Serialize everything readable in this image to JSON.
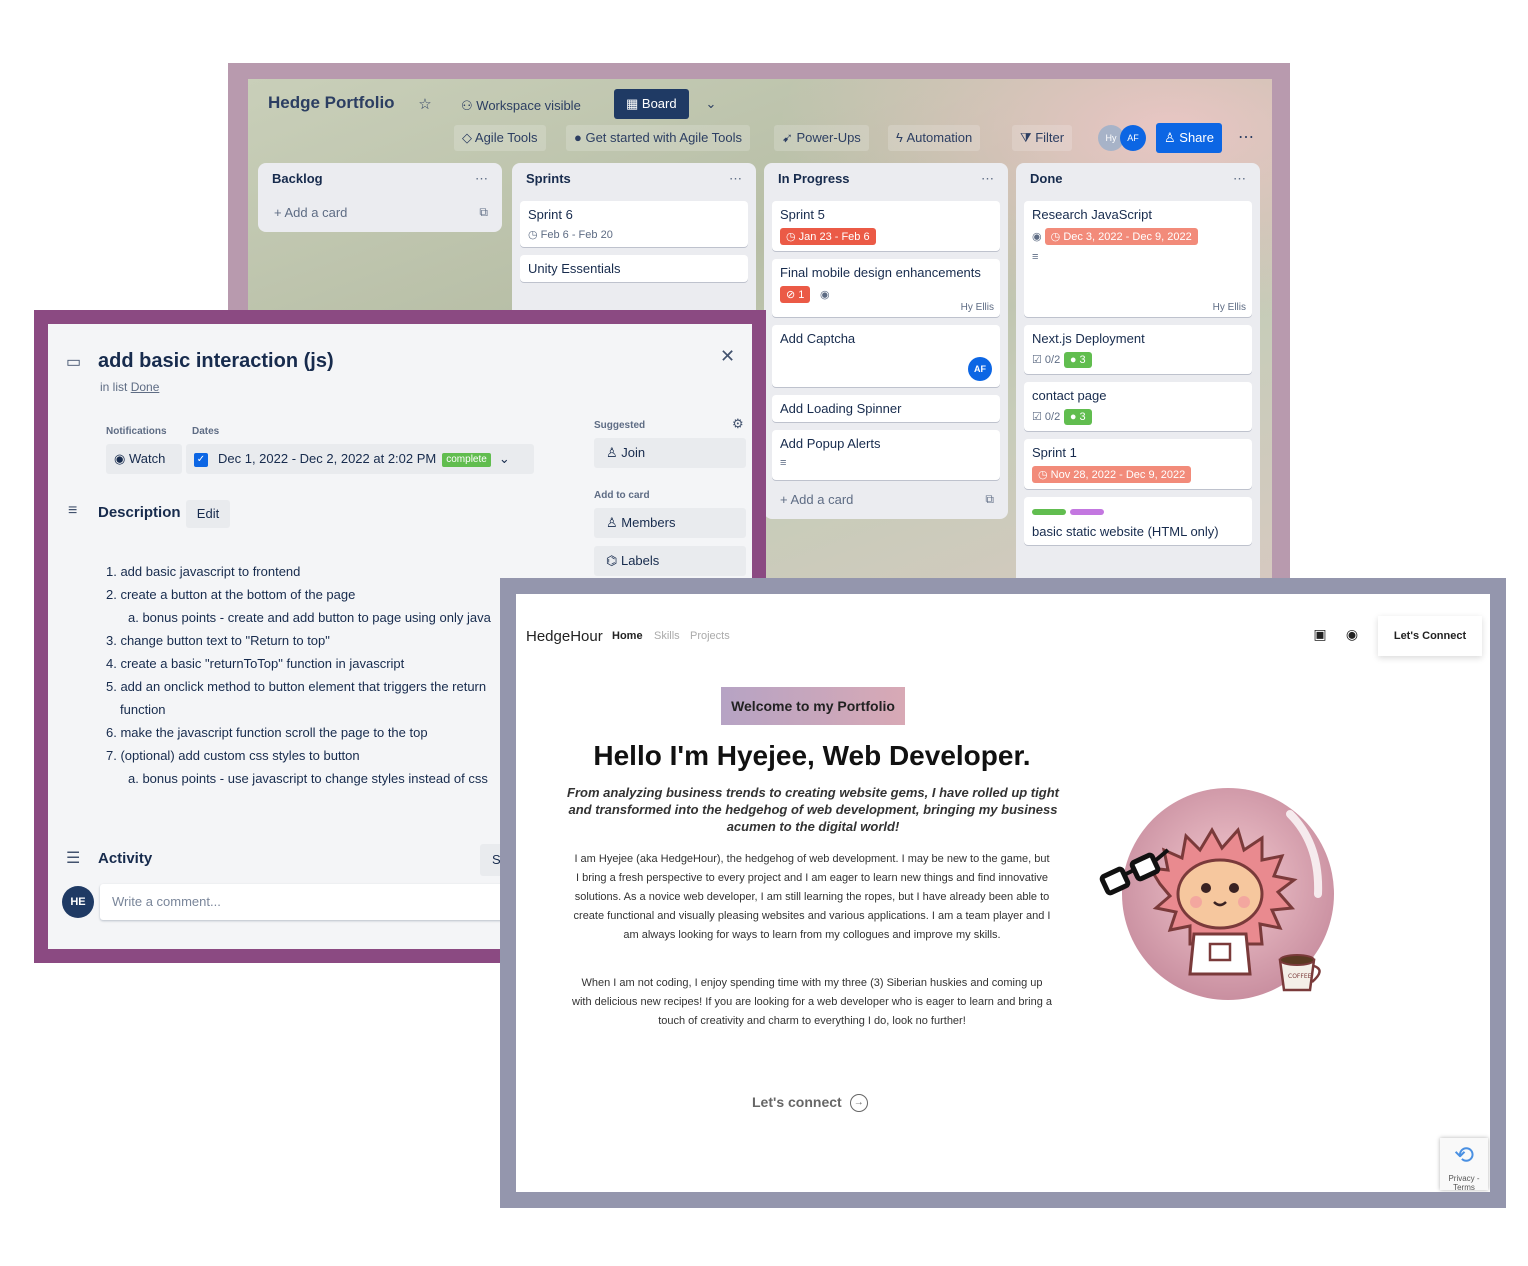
{
  "board": {
    "title": "Hedge Portfolio",
    "star_icon": "☆",
    "visibility": "Workspace visible",
    "view_button": "Board",
    "toolbar": {
      "agile_tools": "Agile Tools",
      "get_started": "Get started with Agile Tools",
      "power_ups": "Power-Ups",
      "automation": "Automation",
      "filter": "Filter",
      "share": "Share"
    },
    "avatars": [
      "Hy",
      "AF"
    ],
    "lists": [
      {
        "name": "Backlog",
        "add_card": "Add a card",
        "cards": []
      },
      {
        "name": "Sprints",
        "cards": [
          {
            "title": "Sprint 6",
            "date": "Feb 6 - Feb 20"
          },
          {
            "title": "Unity Essentials"
          }
        ]
      },
      {
        "name": "In Progress",
        "add_card": "Add a card",
        "cards": [
          {
            "title": "Sprint 5",
            "date": "Jan 23 - Feb 6"
          },
          {
            "title": "Final mobile design enhancements",
            "count": "1",
            "member_alt": "Hy Ellis"
          },
          {
            "title": "Add Captcha",
            "member": "AF"
          },
          {
            "title": "Add Loading Spinner"
          },
          {
            "title": "Add Popup Alerts"
          }
        ]
      },
      {
        "name": "Done",
        "cards": [
          {
            "title": "Research JavaScript",
            "date": "Dec 3, 2022 - Dec 9, 2022",
            "member_alt": "Hy Ellis"
          },
          {
            "title": "Next.js Deployment",
            "checklist": "0/2",
            "count": "3"
          },
          {
            "title": "contact page",
            "checklist": "0/2",
            "count": "3"
          },
          {
            "title": "Sprint 1",
            "date": "Nov 28, 2022 - Dec 9, 2022"
          },
          {
            "title": "basic static website (HTML only)"
          }
        ]
      }
    ]
  },
  "modal": {
    "title": "add basic interaction (js)",
    "in_list_prefix": "in list",
    "in_list": "Done",
    "notifications_label": "Notifications",
    "dates_label": "Dates",
    "watch": "Watch",
    "dates_value": "Dec 1, 2022 - Dec 2, 2022 at 2:02 PM",
    "complete": "complete",
    "description_heading": "Description",
    "edit": "Edit",
    "description": [
      "1. add basic javascript to frontend",
      "2. create a button at the bottom of the page",
      "a. bonus points - create and add button to page using only java",
      "3. change button text to \"Return to top\"",
      "4. create a basic \"returnToTop\" function in javascript",
      "5. add an onclick method to button element that triggers the return",
      "function",
      "6. make the javascript function scroll the page to the top",
      "7. (optional) add custom css styles to button",
      "a. bonus points - use javascript to change styles instead of css"
    ],
    "suggested_label": "Suggested",
    "join": "Join",
    "add_to_card_label": "Add to card",
    "members": "Members",
    "labels": "Labels",
    "activity_heading": "Activity",
    "show": "Sho",
    "avatar": "HE",
    "comment_placeholder": "Write a comment..."
  },
  "site": {
    "logo": "HedgeHour",
    "nav": [
      "Home",
      "Skills",
      "Projects"
    ],
    "connect_button": "Let's Connect",
    "welcome": "Welcome to my Portfolio",
    "headline": "Hello I'm Hyejee, Web Developer.",
    "tagline": "From analyzing business trends to creating website gems, I have rolled up tight and transformed into the hedgehog of web development, bringing my business acumen to the digital world!",
    "para1": "I am Hyejee (aka HedgeHour), the hedgehog of web development. I may be new to the game, but I bring a fresh perspective to every project and I am eager to learn new things and find innovative solutions. As a novice web developer, I am still learning the ropes, but I have already been able to create functional and visually pleasing websites and various applications. I am a team player and I am always looking for ways to learn from my collogues and improve my skills.",
    "para2": "When I am not coding, I enjoy spending time with my three (3) Siberian huskies and coming up with delicious new recipes! If you are looking for a web developer who is eager to learn and bring a touch of creativity and charm to everything I do, look no further!",
    "lets_connect": "Let's connect",
    "coffee_label": "COFFEE",
    "recaptcha_text": "Privacy - Terms"
  },
  "colors": {
    "board_frame": "#b89aae",
    "modal_frame": "#8b4a82",
    "site_frame": "#9496ad",
    "accent_blue": "#0c66e4",
    "label_red": "#eb5a46",
    "label_green": "#61bd4f"
  }
}
